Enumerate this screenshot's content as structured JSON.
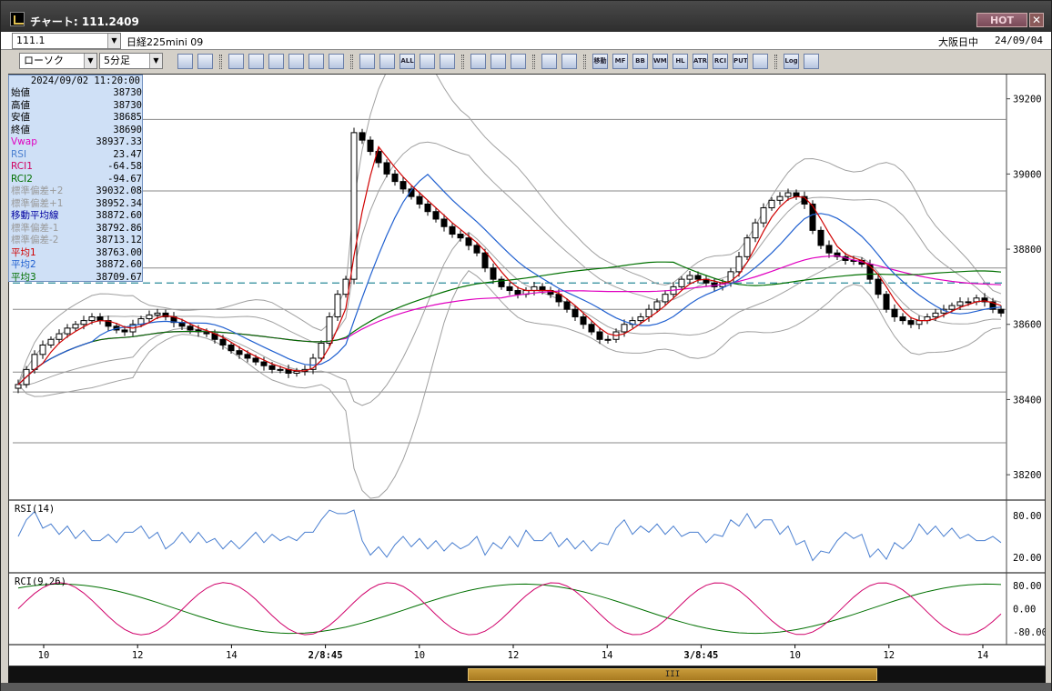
{
  "window": {
    "title": "チャート: 111.2409",
    "hot_label": "HOT",
    "close_label": "✕"
  },
  "header": {
    "code": "111.1",
    "instrument": "日経225mini 09",
    "market": "大阪日中",
    "date": "24/09/04"
  },
  "controls": {
    "chart_type": "ローソク",
    "interval": "5分足"
  },
  "toolbar": {
    "buttons": [
      "zoom-icon",
      "crosshair-icon",
      "line-icon",
      "edit-icon",
      "pointer-icon",
      "redo-icon",
      "print-icon",
      "save-icon",
      "shrink-icon",
      "expand-icon",
      "all",
      "down-arrow-icon",
      "search-icon",
      "candle-icon",
      "indicator-icon",
      "gear-icon",
      "tools-icon",
      "palette-icon",
      "MA",
      "MF",
      "BB",
      "WMA",
      "HL",
      "ATR",
      "RCI",
      "PUT",
      "frame-icon",
      "Log",
      "export-icon"
    ],
    "labels": {
      "all": "ALL",
      "ma": "移動",
      "mf": "MF",
      "bb": "BB",
      "wma": "WMA",
      "hl": "HL",
      "atr": "ATR",
      "rci": "RCI",
      "put": "PUT",
      "log": "Log"
    }
  },
  "data_panel": {
    "datetime": "2024/09/02  11:20:00",
    "rows": [
      {
        "label": "始値",
        "value": "38730",
        "color": "#000000"
      },
      {
        "label": "高値",
        "value": "38730",
        "color": "#000000"
      },
      {
        "label": "安値",
        "value": "38685",
        "color": "#000000"
      },
      {
        "label": "終値",
        "value": "38690",
        "color": "#000000"
      },
      {
        "label": "Vwap",
        "value": "38937.33",
        "color": "#e000c0"
      },
      {
        "label": "RSI",
        "value": "23.47",
        "color": "#4a7fd0"
      },
      {
        "label": "RCI1",
        "value": "-64.58",
        "color": "#d00060"
      },
      {
        "label": "RCI2",
        "value": "-94.67",
        "color": "#007000"
      },
      {
        "label": "標準偏差+2",
        "value": "39032.08",
        "color": "#9a9a9a"
      },
      {
        "label": "標準偏差+1",
        "value": "38952.34",
        "color": "#9a9a9a"
      },
      {
        "label": "移動平均線",
        "value": "38872.60",
        "color": "#0000a0"
      },
      {
        "label": "標準偏差-1",
        "value": "38792.86",
        "color": "#9a9a9a"
      },
      {
        "label": "標準偏差-2",
        "value": "38713.12",
        "color": "#9a9a9a"
      },
      {
        "label": "平均1",
        "value": "38763.00",
        "color": "#d00000"
      },
      {
        "label": "平均2",
        "value": "38872.60",
        "color": "#2060d0"
      },
      {
        "label": "平均3",
        "value": "38709.67",
        "color": "#007000"
      }
    ]
  },
  "chart_data": {
    "type": "candlestick",
    "price_axis": {
      "ticks": [
        "39200",
        "39000",
        "38800",
        "38600",
        "38400",
        "38200"
      ],
      "values": [
        39200,
        39000,
        38800,
        38600,
        38400,
        38200
      ],
      "range": [
        38135,
        39250
      ]
    },
    "time_axis_labels": [
      "10",
      "12",
      "14",
      "2/8:45",
      "10",
      "12",
      "14",
      "3/8:45",
      "10",
      "12",
      "14"
    ],
    "horizontal_levels": [
      39145,
      38955,
      38750,
      38640,
      38473,
      38420,
      38285
    ],
    "dashed_level": 38710,
    "close_path": [
      38440,
      38480,
      38520,
      38545,
      38560,
      38575,
      38590,
      38600,
      38610,
      38620,
      38610,
      38595,
      38585,
      38580,
      38600,
      38615,
      38625,
      38630,
      38620,
      38605,
      38595,
      38585,
      38580,
      38575,
      38560,
      38545,
      38530,
      38520,
      38510,
      38500,
      38490,
      38480,
      38480,
      38470,
      38475,
      38480,
      38510,
      38550,
      38620,
      38680,
      38720,
      39110,
      39090,
      39060,
      39030,
      39000,
      38980,
      38960,
      38940,
      38920,
      38900,
      38880,
      38860,
      38840,
      38830,
      38810,
      38790,
      38750,
      38720,
      38700,
      38690,
      38680,
      38690,
      38700,
      38690,
      38680,
      38660,
      38640,
      38620,
      38600,
      38580,
      38560,
      38560,
      38580,
      38600,
      38610,
      38620,
      38640,
      38660,
      38680,
      38700,
      38720,
      38730,
      38720,
      38710,
      38700,
      38710,
      38740,
      38780,
      38830,
      38870,
      38910,
      38930,
      38940,
      38950,
      38940,
      38920,
      38850,
      38810,
      38790,
      38780,
      38770,
      38770,
      38760,
      38720,
      38680,
      38640,
      38620,
      38610,
      38600,
      38610,
      38620,
      38630,
      38640,
      38650,
      38660,
      38660,
      38670,
      38660,
      38640,
      38630
    ],
    "indicators": {
      "rsi": {
        "label": "RSI(14)",
        "ticks": [
          "80.00",
          "20.00"
        ],
        "values": [
          80,
          20
        ]
      },
      "rci": {
        "label": "RCI(9,26)",
        "ticks": [
          "80.00",
          "0.00",
          "-80.00"
        ],
        "values": [
          80,
          0,
          -80
        ]
      }
    },
    "colors": {
      "vwap": "#e000c0",
      "ma1": "#d00000",
      "ma2": "#2060d0",
      "ma3": "#007000",
      "bands": "#a0a0a0",
      "rsi": "#4a7fd0",
      "rci1": "#d0006a",
      "rci2": "#007000"
    }
  },
  "scrollbar": {
    "thumb_label": "III"
  }
}
